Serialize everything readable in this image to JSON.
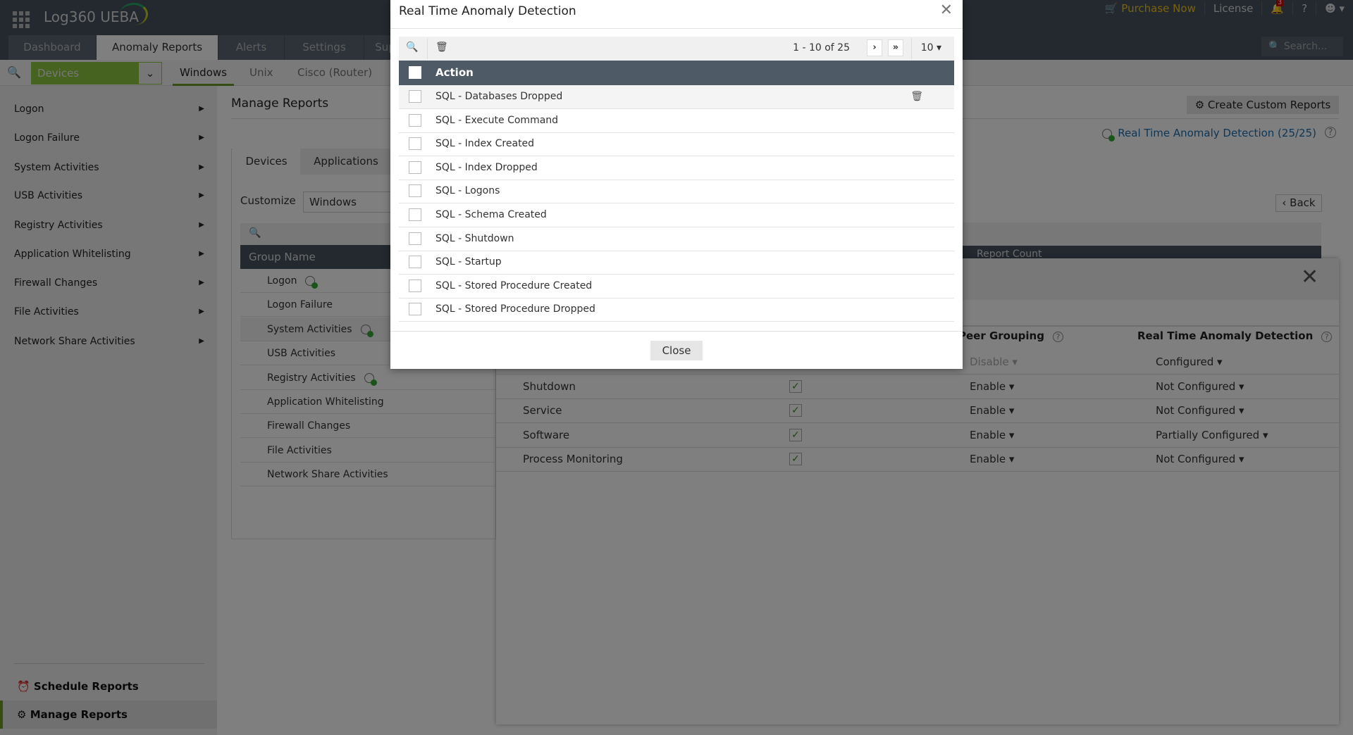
{
  "app": {
    "logo": "Log360",
    "logo_suffix": "UEBA"
  },
  "top_tabs": [
    {
      "label": "Dashboard"
    },
    {
      "label": "Anomaly Reports",
      "active": true
    },
    {
      "label": "Alerts"
    },
    {
      "label": "Settings"
    },
    {
      "label": "Sup"
    }
  ],
  "top_right": {
    "purchase": "Purchase Now",
    "license": "License",
    "notifications": "3",
    "help": "?"
  },
  "search": {
    "placeholder": "Search..."
  },
  "subbar": {
    "device_select": "Devices",
    "os_tabs": [
      {
        "label": "Windows",
        "active": true
      },
      {
        "label": "Unix"
      },
      {
        "label": "Cisco (Router)"
      }
    ]
  },
  "sidebar": {
    "items": [
      {
        "label": "Logon"
      },
      {
        "label": "Logon Failure"
      },
      {
        "label": "System Activities"
      },
      {
        "label": "USB Activities"
      },
      {
        "label": "Registry Activities"
      },
      {
        "label": "Application Whitelisting"
      },
      {
        "label": "Firewall Changes"
      },
      {
        "label": "File Activities"
      },
      {
        "label": "Network Share Activities"
      }
    ],
    "bottom": [
      {
        "label": "Schedule Reports"
      },
      {
        "label": "Manage Reports",
        "active": true
      }
    ]
  },
  "main": {
    "title": "Manage Reports",
    "create_button": "Create Custom Reports",
    "rtad_link": "Real Time Anomaly Detection (25/25)",
    "tabs": [
      {
        "label": "Devices",
        "active": true
      },
      {
        "label": "Applications"
      }
    ],
    "customize_label": "Customize",
    "customize_value": "Windows",
    "group_header": "Group Name",
    "groups": [
      {
        "label": "Logon",
        "rtad": true
      },
      {
        "label": "Logon Failure"
      },
      {
        "label": "System Activities",
        "rtad": true
      },
      {
        "label": "USB Activities"
      },
      {
        "label": "Registry Activities",
        "rtad": true
      },
      {
        "label": "Application Whitelisting"
      },
      {
        "label": "Firewall Changes"
      },
      {
        "label": "File Activities"
      },
      {
        "label": "Network Share Activities"
      }
    ],
    "back": "Back",
    "report_count_header": "Report Count"
  },
  "detail": {
    "headers": {
      "peer_grouping": "Peer Grouping",
      "rtad": "Real Time Anomaly Detection"
    },
    "rows": [
      {
        "name": "",
        "checked": null,
        "peer": "Disable",
        "rtad": "Configured"
      },
      {
        "name": "Shutdown",
        "checked": true,
        "peer": "Enable",
        "rtad": "Not Configured"
      },
      {
        "name": "Service",
        "checked": true,
        "peer": "Enable",
        "rtad": "Not Configured"
      },
      {
        "name": "Software",
        "checked": true,
        "peer": "Enable",
        "rtad": "Partially Configured"
      },
      {
        "name": "Process Monitoring",
        "checked": true,
        "peer": "Enable",
        "rtad": "Not Configured"
      }
    ]
  },
  "modal": {
    "title": "Real Time Anomaly Detection",
    "pagination": "1 - 10 of 25",
    "page_size": "10",
    "column": "Action",
    "rows": [
      {
        "label": "SQL - Databases Dropped"
      },
      {
        "label": "SQL - Execute Command"
      },
      {
        "label": "SQL - Index Created"
      },
      {
        "label": "SQL - Index Dropped"
      },
      {
        "label": "SQL - Logons"
      },
      {
        "label": "SQL - Schema Created"
      },
      {
        "label": "SQL - Shutdown"
      },
      {
        "label": "SQL - Startup"
      },
      {
        "label": "SQL - Stored Procedure Created"
      },
      {
        "label": "SQL - Stored Procedure Dropped"
      }
    ],
    "close": "Close"
  }
}
